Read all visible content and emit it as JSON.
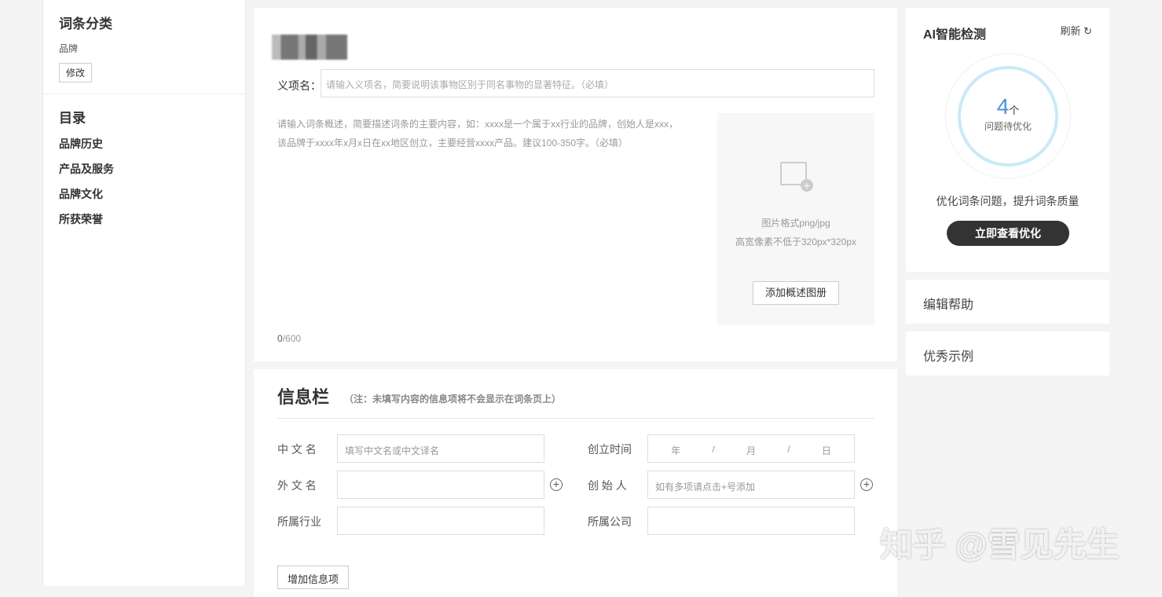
{
  "sidebar": {
    "category_title": "词条分类",
    "category_value": "品牌",
    "edit_label": "修改",
    "toc_title": "目录",
    "toc_items": [
      "品牌历史",
      "产品及服务",
      "品牌文化",
      "所获荣誉"
    ]
  },
  "main": {
    "sense_label": "义项名：",
    "sense_placeholder": "请输入义项名，简要说明该事物区别于同名事物的显著特征。（必填）",
    "summary_placeholder": "请输入词条概述，简要描述词条的主要内容，如：xxxx是一个属于xx行业的品牌，创始人是xxx，该品牌于xxxx年x月x日在xx地区创立，主要经营xxxx产品。建议100-350字。（必填）",
    "count_current": "0",
    "count_max": "/600",
    "image_format": "图片格式png/jpg",
    "image_size": "高宽像素不低于320px*320px",
    "add_album": "添加概述图册"
  },
  "info": {
    "title": "信息栏",
    "note": "（注：未填写内容的信息项将不会显示在词条页上）",
    "fields": [
      {
        "label": "中 文 名",
        "placeholder": "填写中文名或中文译名"
      },
      {
        "label": "外 文 名",
        "placeholder": ""
      },
      {
        "label": "所属行业",
        "placeholder": ""
      },
      {
        "label": "创立时间",
        "placeholder": ""
      },
      {
        "label": "创 始 人",
        "placeholder": "如有多项请点击+号添加"
      },
      {
        "label": "所属公司",
        "placeholder": ""
      }
    ],
    "date": {
      "year": "年",
      "month": "月",
      "day": "日",
      "sep": "/"
    },
    "add_item": "增加信息项"
  },
  "ai": {
    "title": "AI智能检测",
    "refresh": "刷新",
    "count": "4",
    "unit": "个",
    "count_label": "问题待优化",
    "desc": "优化词条问题，提升词条质量",
    "button": "立即查看优化",
    "progress_color": "#c9e9f8"
  },
  "help": "编辑帮助",
  "examples": "优秀示例",
  "watermark": "知乎 @雪见先生"
}
